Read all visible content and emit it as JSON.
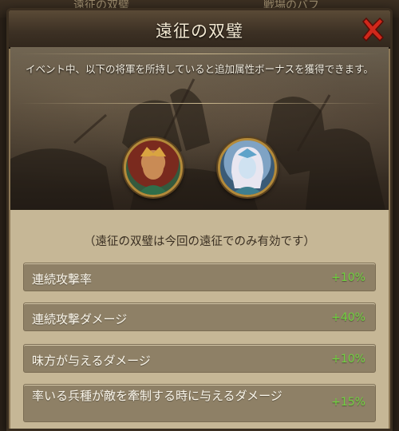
{
  "background_tabs": [
    "遠征の双璧",
    "戦場のバフ"
  ],
  "dialog": {
    "title": "遠征の双璧",
    "close_icon": "close-x-icon",
    "description": "イベント中、以下の将軍を所持していると追加属性ボーナスを獲得できます。",
    "generals": [
      "general-portrait-warrior",
      "general-portrait-priestess"
    ],
    "note": "（遠征の双璧は今回の遠征でのみ有効です）",
    "bonuses": [
      {
        "label": "連続攻撃率",
        "value": "+10%"
      },
      {
        "label": "連続攻撃ダメージ",
        "value": "+40%"
      },
      {
        "label": "味方が与えるダメージ",
        "value": "+10%"
      },
      {
        "label": "率いる兵種が敵を牽制する時に与えるダメージ",
        "value": "+15%"
      }
    ]
  },
  "colors": {
    "bonus_value": "#6fd23f",
    "close_icon": "#d0281b",
    "row_background": "#8e8066",
    "content_background": "#c6b796"
  }
}
